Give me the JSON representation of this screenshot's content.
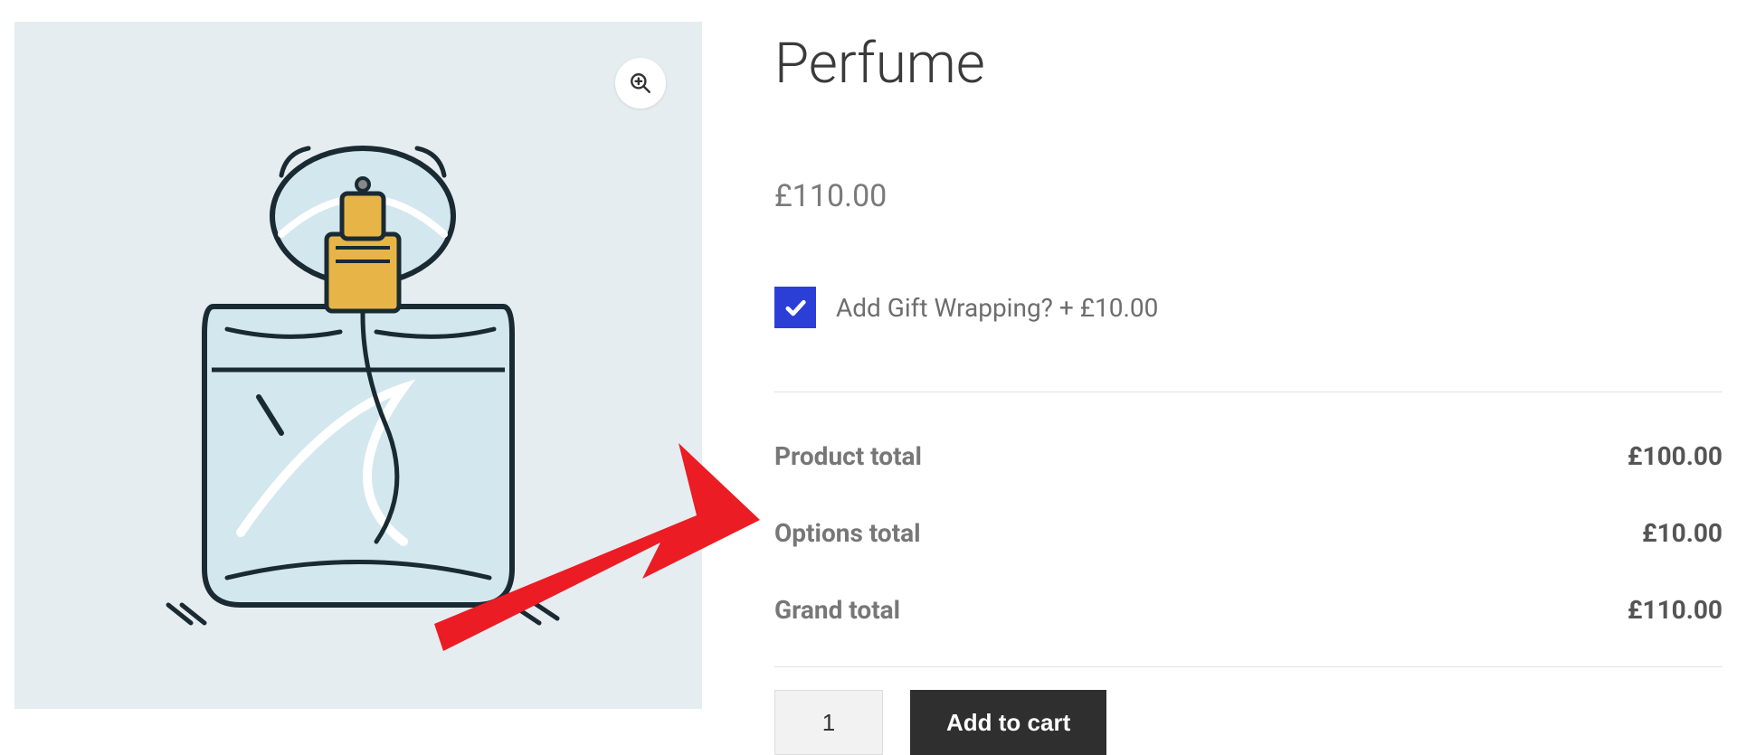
{
  "product": {
    "title": "Perfume",
    "price": "£110.00"
  },
  "addon": {
    "label": "Add Gift Wrapping? + £10.00",
    "checked": true
  },
  "totals": {
    "product_label": "Product total",
    "product_value": "£100.00",
    "options_label": "Options total",
    "options_value": "£10.00",
    "grand_label": "Grand total",
    "grand_value": "£110.00"
  },
  "cart": {
    "quantity": "1",
    "button": "Add to cart"
  }
}
